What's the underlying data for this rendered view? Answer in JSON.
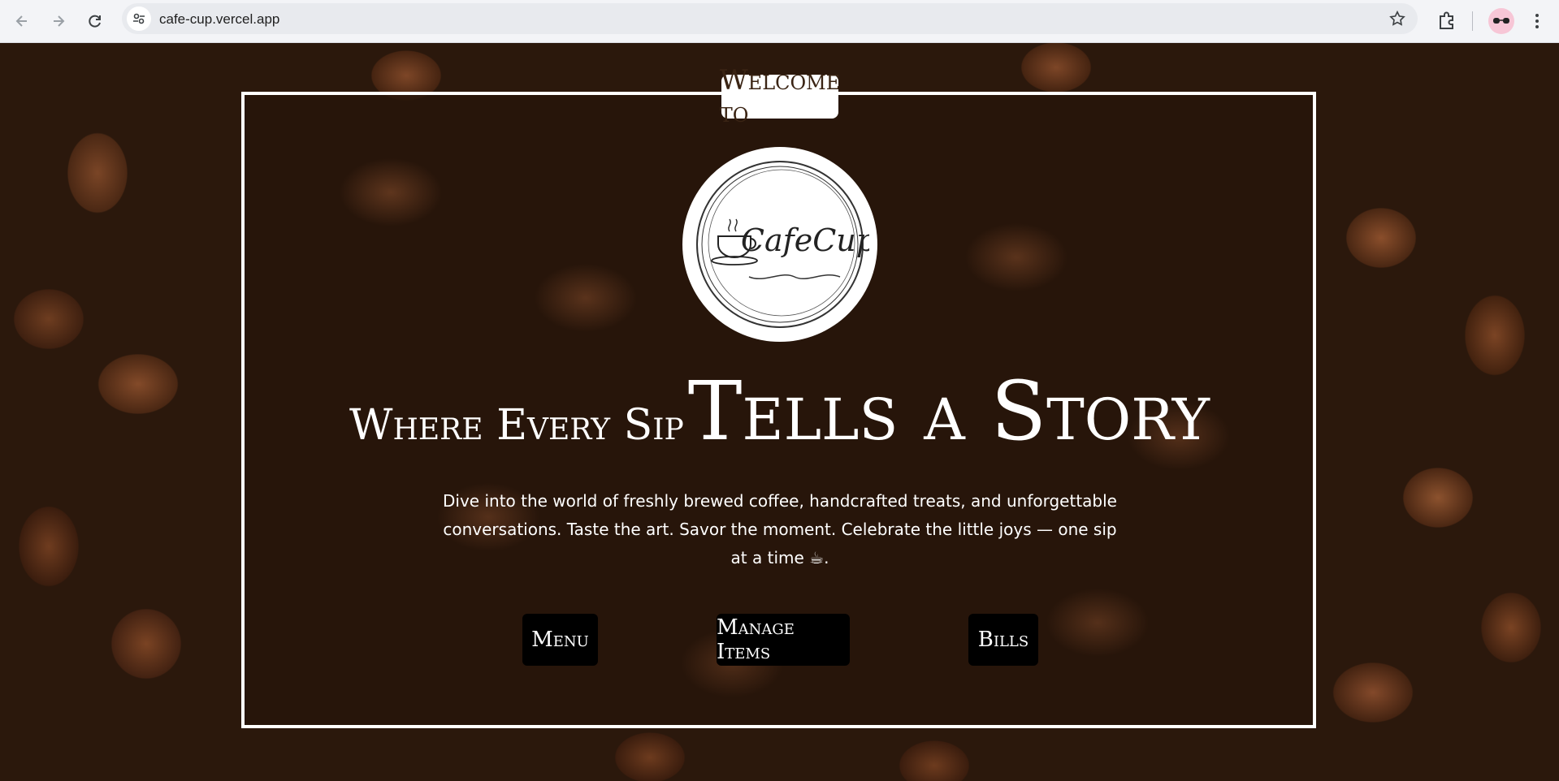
{
  "browser": {
    "url": "cafe-cup.vercel.app",
    "icons": [
      "back-arrow-icon",
      "forward-arrow-icon",
      "reload-icon",
      "site-info-icon",
      "bookmark-star-icon",
      "extensions-icon",
      "profile-avatar-icon",
      "more-menu-icon"
    ]
  },
  "hero": {
    "welcome": "Welcome to",
    "logo_text": "CafeCup",
    "headline_small": "Where Every Sip",
    "headline_big": "Tells a Story",
    "tagline": "Dive into the world of freshly brewed coffee, handcrafted treats, and unforgettable conversations. Taste the art. Savor the moment. Celebrate the little joys — one sip at a time ☕."
  },
  "buttons": {
    "menu": "Menu",
    "manage_items": "Manage Items",
    "bills": "Bills"
  },
  "colors": {
    "frame_border": "#ffffff",
    "button_bg": "#000000",
    "button_text": "#ffffff",
    "background": "#2b180c"
  }
}
